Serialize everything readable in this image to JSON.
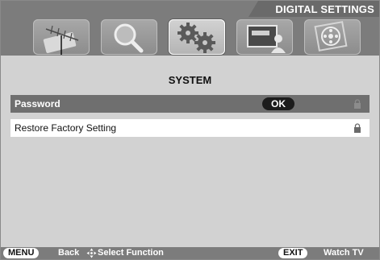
{
  "header": {
    "title": "DIGITAL SETTINGS",
    "menu_icons": [
      {
        "name": "antenna-icon",
        "active": false
      },
      {
        "name": "magnifier-icon",
        "active": false
      },
      {
        "name": "gears-icon",
        "active": true
      },
      {
        "name": "display-person-icon",
        "active": false
      },
      {
        "name": "film-reel-icon",
        "active": false
      }
    ]
  },
  "section_title": "SYSTEM",
  "menu_items": [
    {
      "label": "Password",
      "action_label": "OK",
      "locked": true,
      "selected": true
    },
    {
      "label": "Restore Factory Setting",
      "locked": true,
      "selected": false
    }
  ],
  "footer": {
    "menu_key": "MENU",
    "back_label": "Back",
    "select_label": "Select Function",
    "exit_key": "EXIT",
    "watch_label": "Watch TV"
  },
  "colors": {
    "bar": "#7c7c7c",
    "panel": "#d2d2d2",
    "selected_row": "#6f6f6f",
    "pill_dark": "#1c1c1c"
  }
}
